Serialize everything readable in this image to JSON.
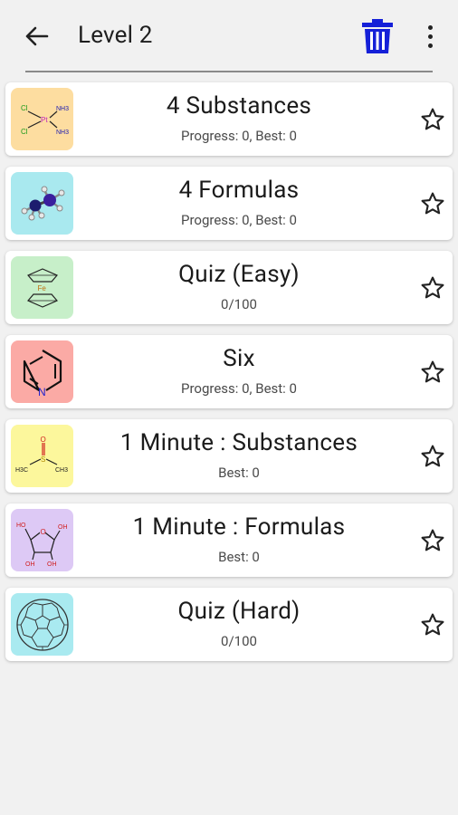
{
  "header": {
    "title": "Level 2",
    "trash_color": "#1520d8"
  },
  "items": [
    {
      "title": "4 Substances",
      "subtitle": "Progress: 0, Best: 0",
      "thumb_color": "#fddda0",
      "icon": "platinum-complex-icon"
    },
    {
      "title": "4 Formulas",
      "subtitle": "Progress: 0, Best: 0",
      "thumb_color": "#a9e9ef",
      "icon": "molecule-model-icon"
    },
    {
      "title": "Quiz (Easy)",
      "subtitle": "0/100",
      "thumb_color": "#c7efc9",
      "icon": "ferrocene-icon"
    },
    {
      "title": "Six",
      "subtitle": "Progress: 0, Best: 0",
      "thumb_color": "#fbaaa5",
      "icon": "pyridine-icon"
    },
    {
      "title": "1 Minute : Substances",
      "subtitle": "Best: 0",
      "thumb_color": "#fcf79c",
      "icon": "dmso-icon"
    },
    {
      "title": "1 Minute : Formulas",
      "subtitle": "Best: 0",
      "thumb_color": "#ddc9f5",
      "icon": "ribose-icon"
    },
    {
      "title": "Quiz (Hard)",
      "subtitle": "0/100",
      "thumb_color": "#a9eaf0",
      "icon": "fullerene-icon"
    }
  ],
  "thumb_labels": {
    "cl1": "Cl",
    "cl2": "Cl",
    "pt": "Pt",
    "nh3a": "NH3",
    "nh3b": "NH3",
    "fe": "Fe",
    "n": "N",
    "h3c": "H3C",
    "ch3": "CH3",
    "o_dmso": "O",
    "s": "S",
    "ho": "HO",
    "oh1": "OH",
    "oh2": "OH",
    "oh3": "OH",
    "o_ring": "O"
  }
}
